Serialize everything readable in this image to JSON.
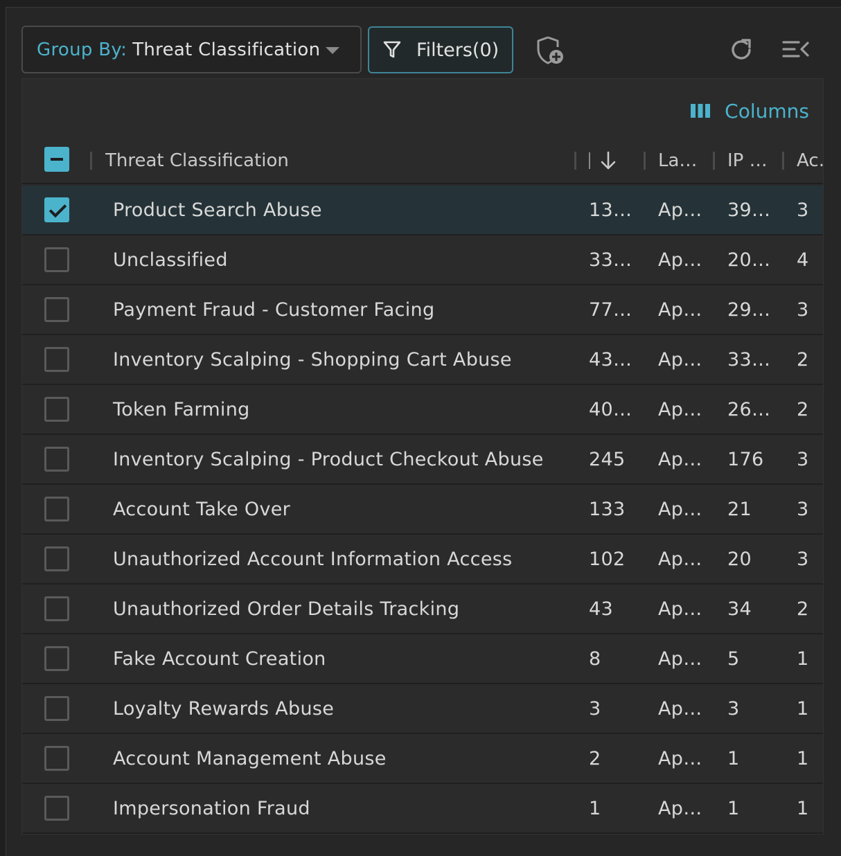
{
  "toolbar": {
    "group_by_prefix": "Group By:",
    "group_by_value": "Threat Classification",
    "filters_label": "Filters(0)"
  },
  "icons": {
    "add_policy": "shield-plus-icon",
    "refresh": "refresh-icon",
    "collapse_panel": "collapse-menu-icon",
    "filter": "filter-funnel-icon",
    "columns": "columns-icon",
    "sort": "sort-descending-icon"
  },
  "colors": {
    "accent": "#4bb3cc",
    "background": "#262626",
    "selected_row": "#253338"
  },
  "grid": {
    "columns_button_label": "Columns",
    "headers": {
      "name": "Threat Classification",
      "count": "",
      "last": "La…",
      "ip": "IP …",
      "ac": "Ac…"
    },
    "rows": [
      {
        "name": "Product Search Abuse",
        "count": "13…",
        "last": "Ap…",
        "ip": "39…",
        "ac": "3",
        "selected": true
      },
      {
        "name": "Unclassified",
        "count": "33…",
        "last": "Ap…",
        "ip": "20…",
        "ac": "4",
        "selected": false
      },
      {
        "name": "Payment Fraud - Customer Facing",
        "count": "77…",
        "last": "Ap…",
        "ip": "29…",
        "ac": "3",
        "selected": false
      },
      {
        "name": "Inventory Scalping - Shopping Cart Abuse",
        "count": "43…",
        "last": "Ap…",
        "ip": "33…",
        "ac": "2",
        "selected": false
      },
      {
        "name": "Token Farming",
        "count": "40…",
        "last": "Ap…",
        "ip": "26…",
        "ac": "2",
        "selected": false
      },
      {
        "name": "Inventory Scalping - Product Checkout Abuse",
        "count": "245",
        "last": "Ap…",
        "ip": "176",
        "ac": "3",
        "selected": false
      },
      {
        "name": "Account Take Over",
        "count": "133",
        "last": "Ap…",
        "ip": "21",
        "ac": "3",
        "selected": false
      },
      {
        "name": "Unauthorized Account Information Access",
        "count": "102",
        "last": "Ap…",
        "ip": "20",
        "ac": "3",
        "selected": false
      },
      {
        "name": "Unauthorized Order Details Tracking",
        "count": "43",
        "last": "Ap…",
        "ip": "34",
        "ac": "2",
        "selected": false
      },
      {
        "name": "Fake Account Creation",
        "count": "8",
        "last": "Ap…",
        "ip": "5",
        "ac": "1",
        "selected": false
      },
      {
        "name": "Loyalty Rewards Abuse",
        "count": "3",
        "last": "Ap…",
        "ip": "3",
        "ac": "1",
        "selected": false
      },
      {
        "name": "Account Management Abuse",
        "count": "2",
        "last": "Ap…",
        "ip": "1",
        "ac": "1",
        "selected": false
      },
      {
        "name": "Impersonation Fraud",
        "count": "1",
        "last": "Ap…",
        "ip": "1",
        "ac": "1",
        "selected": false
      }
    ]
  }
}
